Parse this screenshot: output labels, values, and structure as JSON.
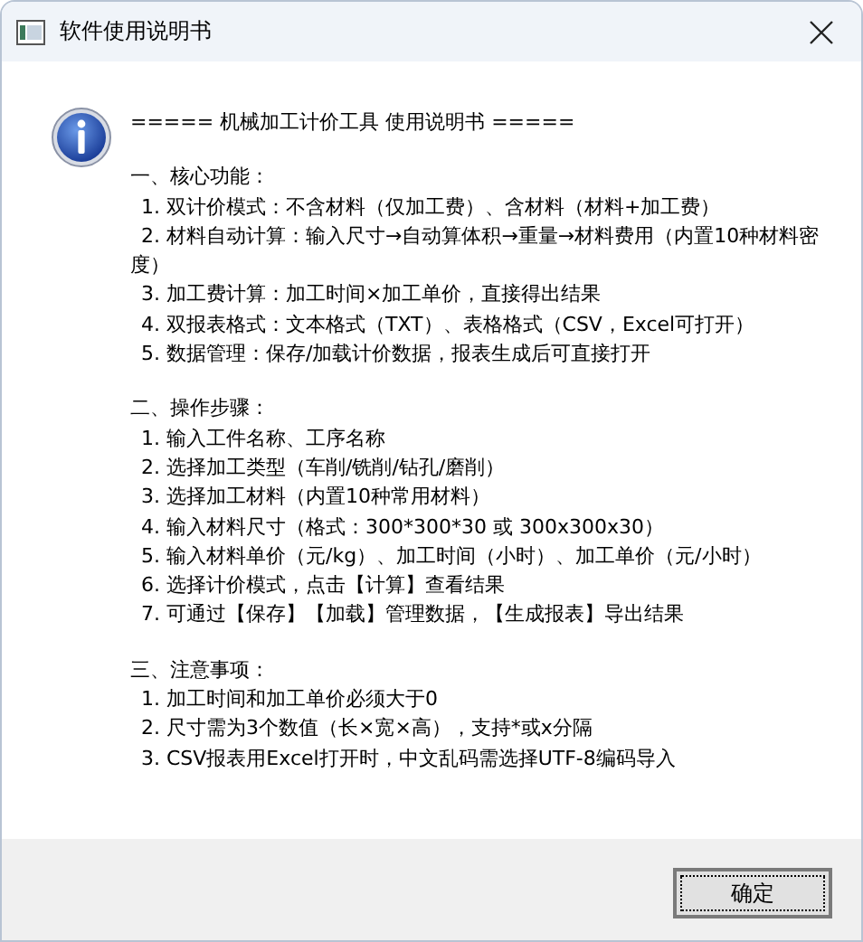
{
  "window": {
    "title": "软件使用说明书"
  },
  "message": {
    "header": "===== 机械加工计价工具 使用说明书 =====",
    "sections": [
      {
        "heading": "一、核心功能：",
        "items": [
          "1. 双计价模式：不含材料（仅加工费）、含材料（材料+加工费）",
          "2. 材料自动计算：输入尺寸→自动算体积→重量→材料费用（内置10种材料密度）",
          "3. 加工费计算：加工时间×加工单价，直接得出结果",
          "4. 双报表格式：文本格式（TXT）、表格格式（CSV，Excel可打开）",
          "5. 数据管理：保存/加载计价数据，报表生成后可直接打开"
        ]
      },
      {
        "heading": "二、操作步骤：",
        "items": [
          "1. 输入工件名称、工序名称",
          "2. 选择加工类型（车削/铣削/钻孔/磨削）",
          "3. 选择加工材料（内置10种常用材料）",
          "4. 输入材料尺寸（格式：300*300*30 或 300x300x30）",
          "5. 输入材料单价（元/kg）、加工时间（小时）、加工单价（元/小时）",
          "6. 选择计价模式，点击【计算】查看结果",
          "7. 可通过【保存】【加载】管理数据，【生成报表】导出结果"
        ]
      },
      {
        "heading": "三、注意事项：",
        "items": [
          "1. 加工时间和加工单价必须大于0",
          "2. 尺寸需为3个数值（长×宽×高），支持*或x分隔",
          "3. CSV报表用Excel打开时，中文乱码需选择UTF-8编码导入"
        ]
      }
    ]
  },
  "buttons": [
    {
      "label": "确定",
      "selected": true
    }
  ]
}
